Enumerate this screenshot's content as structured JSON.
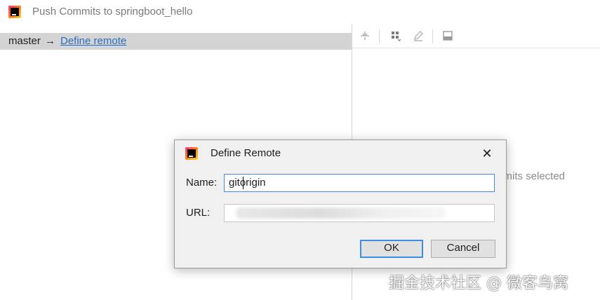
{
  "window": {
    "title": "Push Commits to springboot_hello",
    "icon": "intellij-idea-icon"
  },
  "left_pane": {
    "branch": "master",
    "arrow": "→",
    "define_remote_link": "Define remote"
  },
  "right_pane": {
    "empty_text": "mmits selected"
  },
  "dialog": {
    "title": "Define Remote",
    "name_label": "Name:",
    "name_value": "gitorigin",
    "url_label": "URL:",
    "url_value": "",
    "ok_label": "OK",
    "cancel_label": "Cancel",
    "close_glyph": "✕"
  },
  "watermark": "掘金技术社区 @ 微客鸟窝",
  "colors": {
    "link": "#2a6cc0",
    "selection": "#d4d4d4",
    "focus": "#3d8ee0"
  }
}
